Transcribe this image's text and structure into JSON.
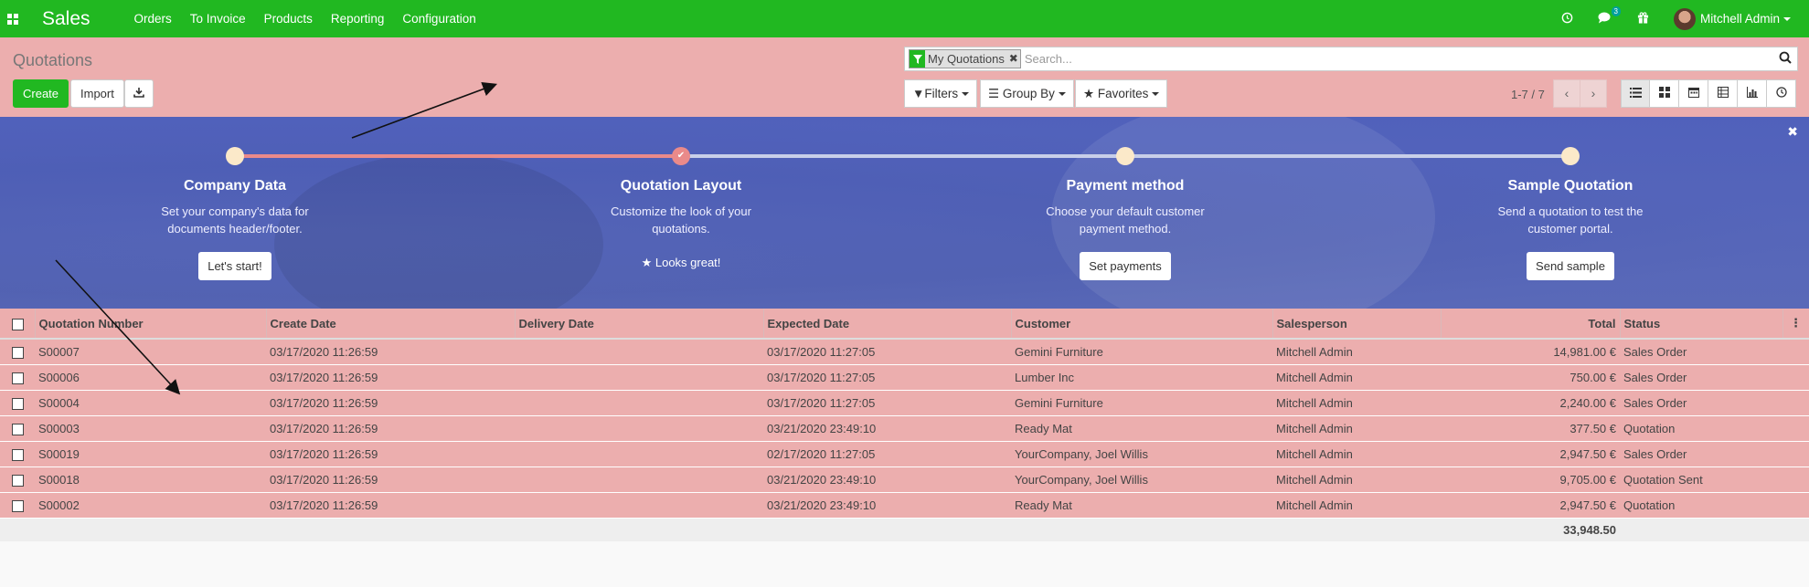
{
  "app": {
    "title": "Sales"
  },
  "nav": {
    "menu": [
      "Orders",
      "To Invoice",
      "Products",
      "Reporting",
      "Configuration"
    ],
    "messages_count": "3",
    "user_name": "Mitchell Admin"
  },
  "control": {
    "page_title": "Quotations",
    "create_label": "Create",
    "import_label": "Import",
    "facet_label": "My Quotations",
    "search_placeholder": "Search...",
    "filters_label": "Filters",
    "groupby_label": "Group By",
    "favorites_label": "Favorites",
    "pager_value": "1-7 / 7"
  },
  "onboarding": {
    "steps": [
      {
        "title": "Company Data",
        "desc1": "Set your company's data for",
        "desc2": "documents header/footer.",
        "button": "Let's start!"
      },
      {
        "title": "Quotation Layout",
        "desc1": "Customize the look of your",
        "desc2": "quotations.",
        "done": "Looks great!"
      },
      {
        "title": "Payment method",
        "desc1": "Choose your default customer",
        "desc2": "payment method.",
        "button": "Set payments"
      },
      {
        "title": "Sample Quotation",
        "desc1": "Send a quotation to test the",
        "desc2": "customer portal.",
        "button": "Send sample"
      }
    ]
  },
  "table": {
    "headers": [
      "Quotation Number",
      "Create Date",
      "Delivery Date",
      "Expected Date",
      "Customer",
      "Salesperson",
      "Total",
      "Status"
    ],
    "rows": [
      {
        "number": "S00007",
        "create": "03/17/2020 11:26:59",
        "delivery": "",
        "expected": "03/17/2020 11:27:05",
        "customer": "Gemini Furniture",
        "salesperson": "Mitchell Admin",
        "total": "14,981.00 €",
        "status": "Sales Order"
      },
      {
        "number": "S00006",
        "create": "03/17/2020 11:26:59",
        "delivery": "",
        "expected": "03/17/2020 11:27:05",
        "customer": "Lumber Inc",
        "salesperson": "Mitchell Admin",
        "total": "750.00 €",
        "status": "Sales Order"
      },
      {
        "number": "S00004",
        "create": "03/17/2020 11:26:59",
        "delivery": "",
        "expected": "03/17/2020 11:27:05",
        "customer": "Gemini Furniture",
        "salesperson": "Mitchell Admin",
        "total": "2,240.00 €",
        "status": "Sales Order"
      },
      {
        "number": "S00003",
        "create": "03/17/2020 11:26:59",
        "delivery": "",
        "expected": "03/21/2020 23:49:10",
        "customer": "Ready Mat",
        "salesperson": "Mitchell Admin",
        "total": "377.50 €",
        "status": "Quotation"
      },
      {
        "number": "S00019",
        "create": "03/17/2020 11:26:59",
        "delivery": "",
        "expected": "02/17/2020 11:27:05",
        "customer": "YourCompany, Joel Willis",
        "salesperson": "Mitchell Admin",
        "total": "2,947.50 €",
        "status": "Sales Order"
      },
      {
        "number": "S00018",
        "create": "03/17/2020 11:26:59",
        "delivery": "",
        "expected": "03/21/2020 23:49:10",
        "customer": "YourCompany, Joel Willis",
        "salesperson": "Mitchell Admin",
        "total": "9,705.00 €",
        "status": "Quotation Sent"
      },
      {
        "number": "S00002",
        "create": "03/17/2020 11:26:59",
        "delivery": "",
        "expected": "03/21/2020 23:49:10",
        "customer": "Ready Mat",
        "salesperson": "Mitchell Admin",
        "total": "2,947.50 €",
        "status": "Quotation"
      }
    ],
    "footer_total": "33,948.50"
  },
  "colors": {
    "nav": "#21b821",
    "highlight": "#ecaeae",
    "banner": "#5a6cc6",
    "progress_done": "#ea8a8a"
  },
  "icons": [
    "apps-icon",
    "clock-icon",
    "chat-icon",
    "gift-icon",
    "filter-icon",
    "search-icon",
    "download-icon",
    "list-view-icon",
    "kanban-view-icon",
    "calendar-view-icon",
    "pivot-view-icon",
    "graph-view-icon",
    "activity-view-icon",
    "close-icon",
    "star-icon",
    "check-icon"
  ]
}
